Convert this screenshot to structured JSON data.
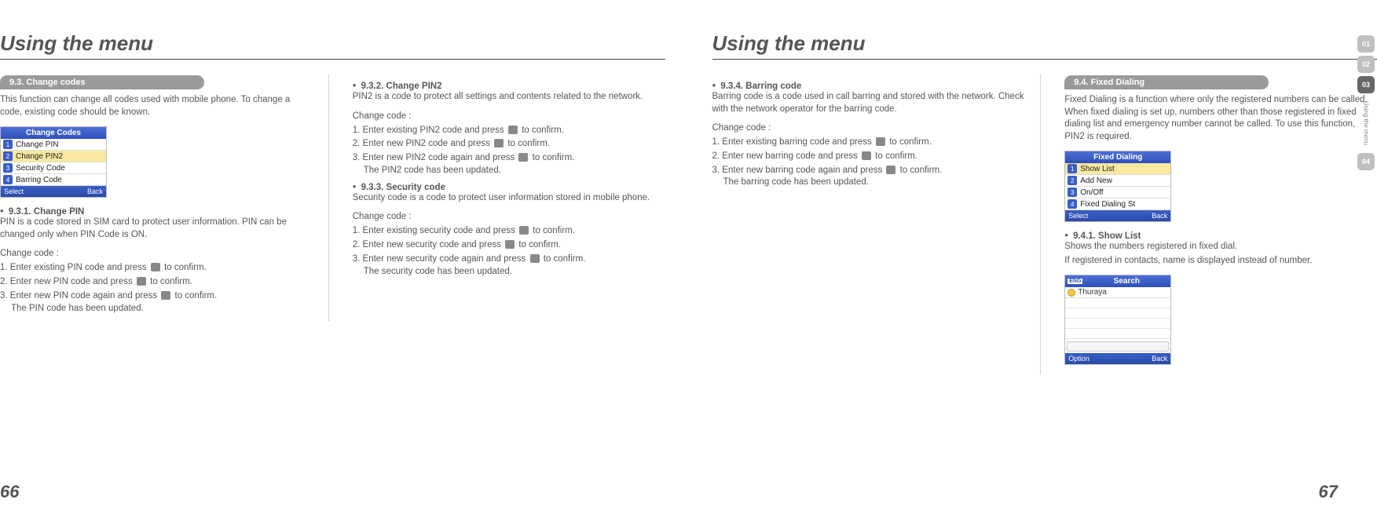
{
  "leftPage": {
    "title": "Using the menu",
    "pageNumber": "66",
    "section93": {
      "pill": "9.3. Change codes",
      "intro": "This function can change all codes used with mobile phone. To change a code, existing code should be known.",
      "screenshot": {
        "title": "Change Codes",
        "items": [
          "Change PIN",
          "Change PIN2",
          "Security Code",
          "Barring Code"
        ],
        "selectedIndex": 1,
        "softLeft": "Select",
        "softRight": "Back"
      },
      "s931": {
        "title": "9.3.1. Change PIN",
        "desc": "PIN is a code stored in SIM card to protect user information. PIN can be changed only when PIN Code is ON.",
        "changeLabel": "Change code :",
        "steps": [
          "1. Enter existing PIN code and press",
          "2. Enter new PIN code and press",
          "3. Enter new PIN code again and press"
        ],
        "suffix": "to confirm.",
        "result": "The PIN code has been updated."
      },
      "s932": {
        "title": "9.3.2. Change PIN2",
        "desc": "PIN2 is a code to protect all settings and contents related to the network.",
        "changeLabel": "Change code :",
        "steps": [
          "1. Enter existing PIN2 code and press",
          "2. Enter new PIN2 code and press",
          "3. Enter new PIN2 code again and press"
        ],
        "suffix": "to confirm.",
        "result": "The PIN2 code has been updated."
      },
      "s933": {
        "title": "9.3.3. Security code",
        "desc": "Security code is a code to protect user information stored in mobile phone.",
        "changeLabel": "Change code :",
        "steps": [
          "1. Enter existing security code and press",
          "2. Enter new security code and press",
          "3. Enter new security code again and press"
        ],
        "suffix": "to confirm.",
        "result": "The security code has been updated."
      }
    }
  },
  "rightPage": {
    "title": "Using the menu",
    "pageNumber": "67",
    "s934": {
      "title": "9.3.4. Barring code",
      "desc": "Barring code is a code used in call barring and stored with the network. Check with the network operator for the barring code.",
      "changeLabel": "Change code :",
      "steps": [
        "1. Enter existing barring code and press",
        "2. Enter new barring  code and press",
        "3. Enter new  barring  code again and press"
      ],
      "suffix": "to confirm.",
      "result": "The  barring  code has been updated."
    },
    "section94": {
      "pill": "9.4. Fixed Dialing",
      "intro": "Fixed Dialing is a function where only the registered numbers can be called. When fixed dialing is set up, numbers other than those registered in fixed dialing list and emergency number cannot be called. To use this function, PIN2 is required.",
      "screenshot": {
        "title": "Fixed Dialing",
        "items": [
          "Show List",
          "Add New",
          "On/Off",
          "Fixed Dialing St"
        ],
        "selectedIndex": 0,
        "softLeft": "Select",
        "softRight": "Back"
      },
      "s941": {
        "title": "9.4.1. Show List",
        "line1": "Shows the numbers registered in fixed dial.",
        "line2": "If registered in contacts, name is displayed instead of number."
      },
      "searchShot": {
        "engLabel": "ENG",
        "title": "Search",
        "brand": "Thuraya",
        "softLeft": "Option",
        "softRight": "Back"
      }
    },
    "tabs": {
      "t1": "01",
      "t2": "02",
      "t3": "03",
      "t4": "04",
      "vert": "Using the menu"
    }
  }
}
